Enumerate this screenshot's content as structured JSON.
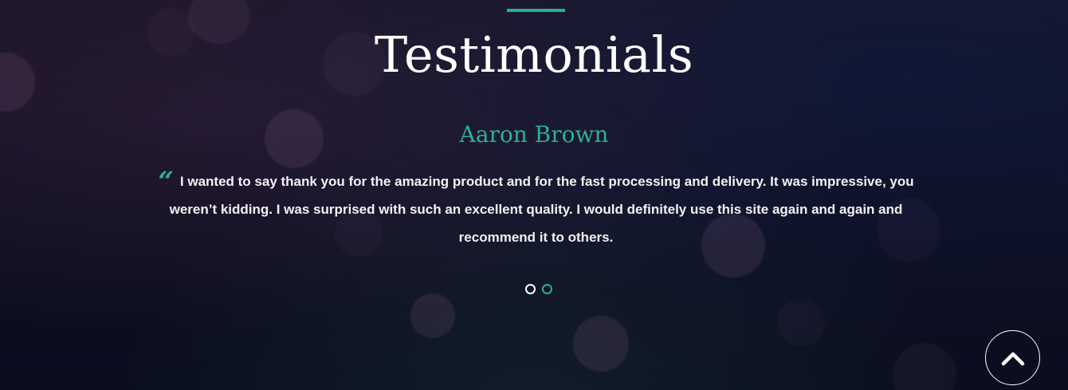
{
  "section": {
    "title": "Testimonials",
    "accent_color": "#2bb18e"
  },
  "testimonial": {
    "author": "Aaron Brown",
    "quote_icon": "quote-open-icon",
    "text": "I wanted to say thank you for the amazing product and for the fast processing and delivery. It was impressive, you weren’t kidding. I was surprised with such an excellent quality. I would definitely use this site again and again and recommend it to others."
  },
  "carousel": {
    "slides": 2,
    "active_slide": 2
  },
  "back_to_top": {
    "icon": "chevron-up-icon"
  }
}
